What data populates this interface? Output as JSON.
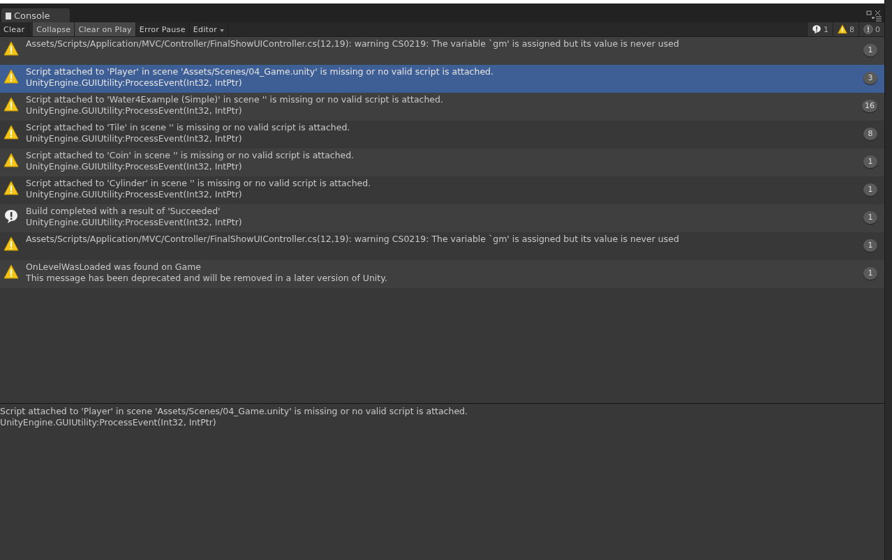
{
  "window": {
    "title": "Console"
  },
  "toolbar": {
    "buttons": [
      {
        "label": "Clear",
        "on": false
      },
      {
        "label": "Collapse",
        "on": true
      },
      {
        "label": "Clear on Play",
        "on": true
      },
      {
        "label": "Error Pause",
        "on": false
      }
    ],
    "dropdown": {
      "label": "Editor"
    },
    "counters": [
      {
        "kind": "info",
        "count": "1"
      },
      {
        "kind": "warning",
        "count": "8"
      },
      {
        "kind": "error",
        "count": "0"
      }
    ]
  },
  "entries": [
    {
      "kind": "warning",
      "selected": false,
      "lines": [
        "Assets/Scripts/Application/MVC/Controller/FinalShowUIController.cs(12,19): warning CS0219: The variable `gm' is assigned but its value is never used"
      ],
      "count": "1"
    },
    {
      "kind": "warning",
      "selected": true,
      "lines": [
        "Script attached to 'Player' in scene 'Assets/Scenes/04_Game.unity' is missing or no valid script is attached.",
        "UnityEngine.GUIUtility:ProcessEvent(Int32, IntPtr)"
      ],
      "count": "3"
    },
    {
      "kind": "warning",
      "selected": false,
      "lines": [
        "Script attached to 'Water4Example (Simple)' in scene '' is missing or no valid script is attached.",
        "UnityEngine.GUIUtility:ProcessEvent(Int32, IntPtr)"
      ],
      "count": "16"
    },
    {
      "kind": "warning",
      "selected": false,
      "lines": [
        "Script attached to 'Tile' in scene '' is missing or no valid script is attached.",
        "UnityEngine.GUIUtility:ProcessEvent(Int32, IntPtr)"
      ],
      "count": "8"
    },
    {
      "kind": "warning",
      "selected": false,
      "lines": [
        "Script attached to 'Coin' in scene '' is missing or no valid script is attached.",
        "UnityEngine.GUIUtility:ProcessEvent(Int32, IntPtr)"
      ],
      "count": "1"
    },
    {
      "kind": "warning",
      "selected": false,
      "lines": [
        "Script attached to 'Cylinder' in scene '' is missing or no valid script is attached.",
        "UnityEngine.GUIUtility:ProcessEvent(Int32, IntPtr)"
      ],
      "count": "1"
    },
    {
      "kind": "info",
      "selected": false,
      "lines": [
        "Build completed with a result of 'Succeeded'",
        "UnityEngine.GUIUtility:ProcessEvent(Int32, IntPtr)"
      ],
      "count": "1"
    },
    {
      "kind": "warning",
      "selected": false,
      "lines": [
        "Assets/Scripts/Application/MVC/Controller/FinalShowUIController.cs(12,19): warning CS0219: The variable `gm' is assigned but its value is never used"
      ],
      "count": "1"
    },
    {
      "kind": "warning",
      "selected": false,
      "lines": [
        "OnLevelWasLoaded was found on Game",
        "This message has been deprecated and will be removed in a later version of Unity."
      ],
      "count": "1"
    }
  ],
  "detail": {
    "lines": [
      "Script attached to 'Player' in scene 'Assets/Scenes/04_Game.unity' is missing or no valid script is attached.",
      "UnityEngine.GUIUtility:ProcessEvent(Int32, IntPtr)"
    ]
  }
}
